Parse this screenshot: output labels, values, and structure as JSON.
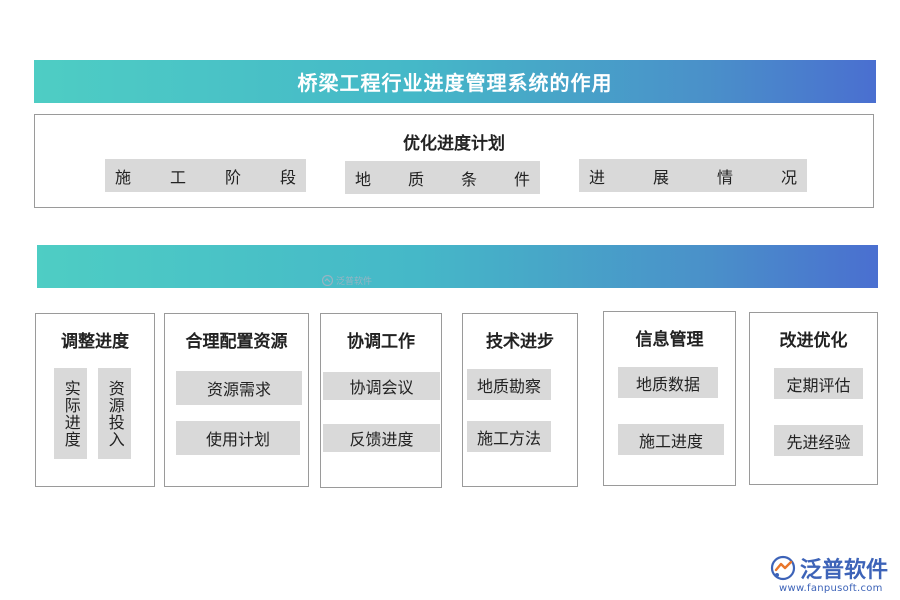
{
  "title": "桥梁工程行业进度管理系统的作用",
  "optimize": {
    "title": "优化进度计划",
    "items": [
      [
        "施",
        "工",
        "阶",
        "段"
      ],
      [
        "地",
        "质",
        "条",
        "件"
      ],
      [
        "进",
        "展",
        "情",
        "况"
      ]
    ]
  },
  "watermark": "泛普软件",
  "cards": [
    {
      "title": "调整进度",
      "items": [
        "实际进度",
        "资源投入"
      ]
    },
    {
      "title": "合理配置资源",
      "items": [
        "资源需求",
        "使用计划"
      ]
    },
    {
      "title": "协调工作",
      "items": [
        "协调会议",
        "反馈进度"
      ]
    },
    {
      "title": "技术进步",
      "items": [
        "地质勘察",
        "施工方法"
      ]
    },
    {
      "title": "信息管理",
      "items": [
        "地质数据",
        "施工进度"
      ]
    },
    {
      "title": "改进优化",
      "items": [
        "定期评估",
        "先进经验"
      ]
    }
  ],
  "logo": {
    "name": "泛普软件",
    "url": "www.fanpusoft.com"
  },
  "colors": {
    "banner_start": "#4ecdc4",
    "banner_end": "#4a6fd0",
    "tag_bg": "#d9d9d9",
    "logo": "#3d63b8"
  }
}
